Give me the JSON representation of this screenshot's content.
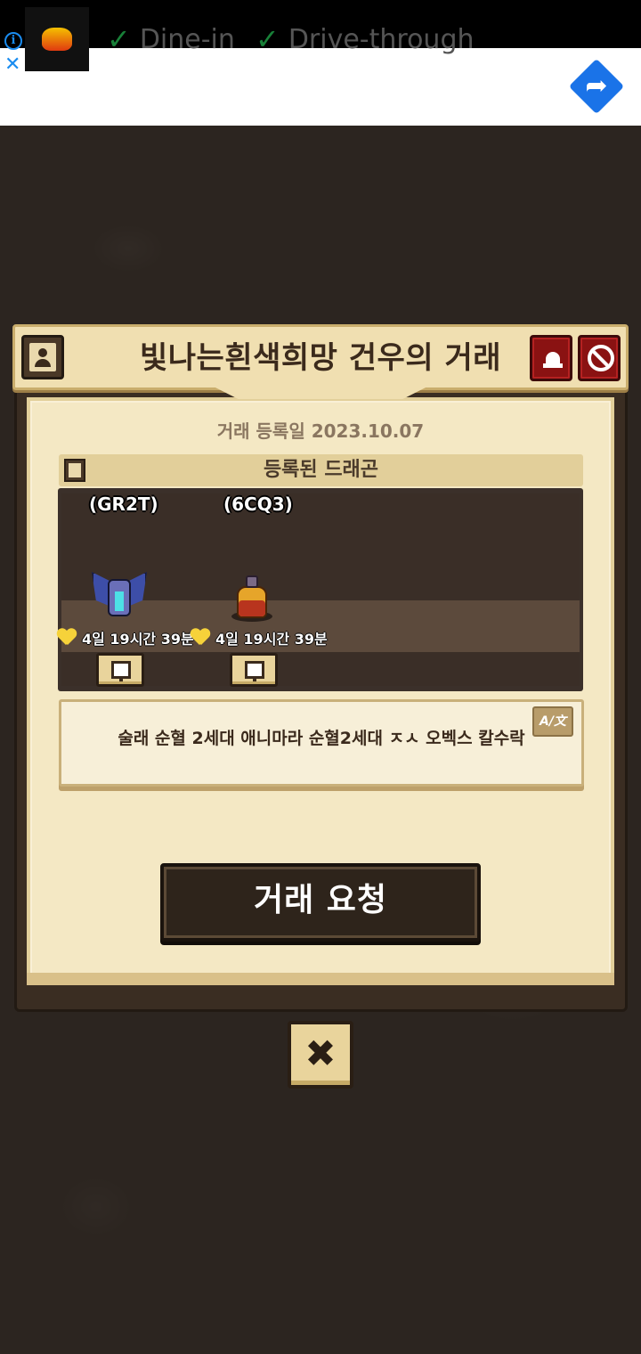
{
  "ad": {
    "info_icon": "info-icon",
    "close_icon": "close-icon",
    "item1": "Dine-in",
    "item2": "Drive-through",
    "check": "✓",
    "direction_icon": "directions-icon"
  },
  "modal": {
    "title": "빛나는흰색희망  건우의 거래",
    "register_date": "거래 등록일 2023.10.07",
    "dragon_header": "등록된 드래곤",
    "dragons": [
      {
        "code": "(GR2T)",
        "timer": "4일 19시간 39분"
      },
      {
        "code": "(6CQ3)",
        "timer": "4일 19시간 39분"
      }
    ],
    "message": "술래 순혈 2세대 애니마라 순혈2세대 ㅈㅅ 오벡스 칼수락",
    "translate_label": "A/文",
    "trade_button": "거래 요청",
    "close_symbol": "✖"
  },
  "colors": {
    "background": "#2c2520",
    "panel": "#f4e8c4",
    "danger": "#8a1212"
  }
}
